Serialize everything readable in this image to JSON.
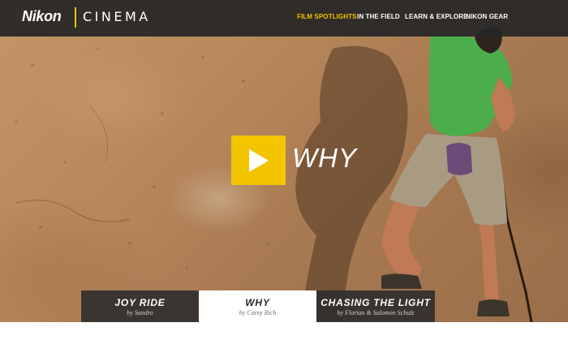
{
  "brand": {
    "logo_text": "Nikon",
    "cinema_text": "CINEMA"
  },
  "nav": {
    "items": [
      {
        "label": "FILM SPOTLIGHTS",
        "active": true
      },
      {
        "label": "IN THE FIELD",
        "active": false
      },
      {
        "label": "LEARN & EXPLORE",
        "active": false
      },
      {
        "label": "NIKON GEAR",
        "active": false
      }
    ]
  },
  "hero": {
    "title": "WHY",
    "play_icon": "play-icon"
  },
  "films": [
    {
      "title": "JOY RIDE",
      "byline": "by Sandro",
      "active": false
    },
    {
      "title": "WHY",
      "byline": "by Corey Rich",
      "active": true
    },
    {
      "title": "CHASING THE LIGHT",
      "byline": "by Florian & Salomon Schulz",
      "active": false
    }
  ],
  "colors": {
    "accent": "#f2c500",
    "bar": "#262626",
    "rock": "#b8875c",
    "shirt": "#4cae4a"
  }
}
